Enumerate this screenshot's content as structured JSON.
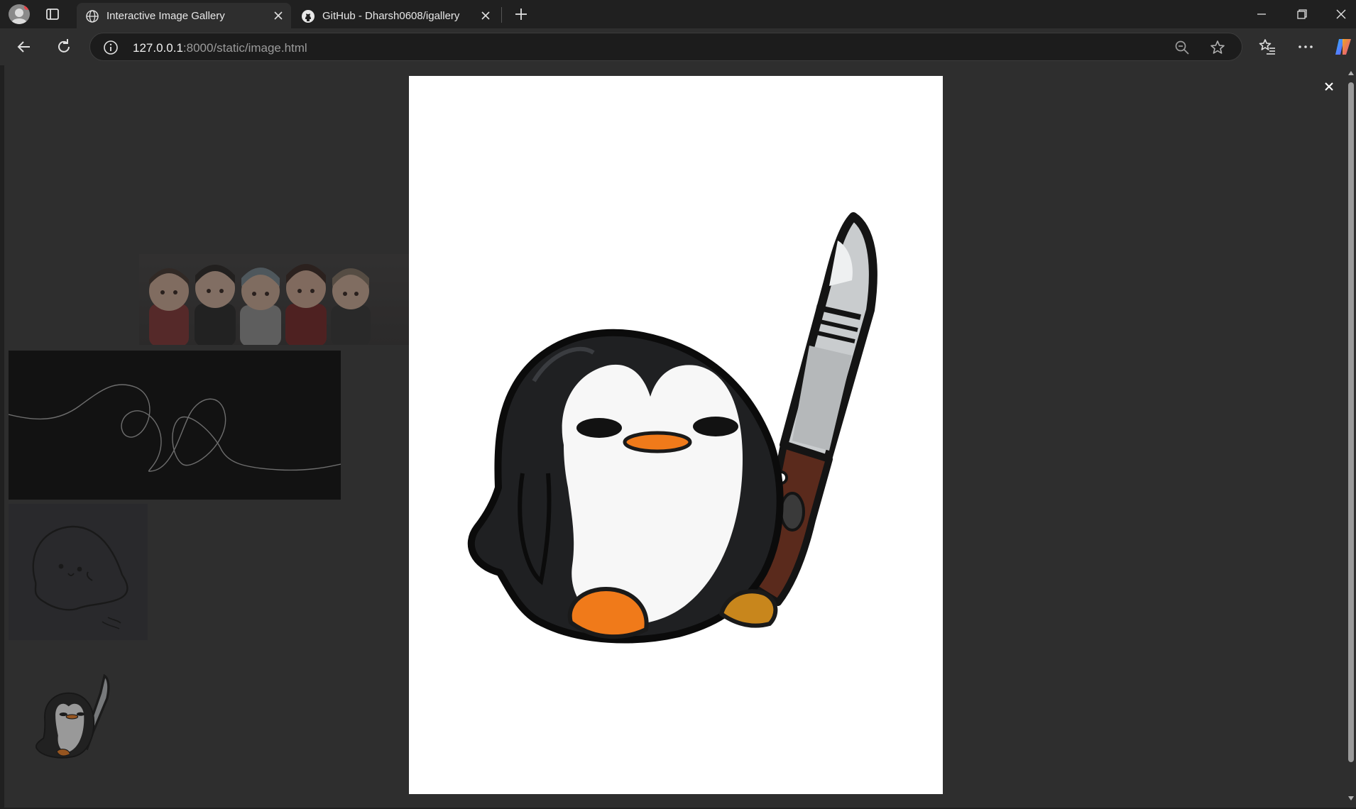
{
  "browser": {
    "tabs": [
      {
        "title": "Interactive Image Gallery",
        "icon": "globe-icon",
        "active": true
      },
      {
        "title": "GitHub - Dharsh0608/igallery",
        "icon": "github-icon",
        "active": false
      }
    ],
    "address": {
      "host": "127.0.0.1",
      "rest": ":8000/static/image.html"
    }
  },
  "gallery": {
    "images": [
      {
        "name": "bts-chibi-group"
      },
      {
        "name": "heart-line-art"
      },
      {
        "name": "ghost-sketch"
      },
      {
        "name": "penguin-with-knife"
      }
    ],
    "lightbox": {
      "image": "penguin-with-knife",
      "open": true
    }
  },
  "colors": {
    "page_bg": "#333333",
    "lightbox_bg": "#ffffff",
    "penguin_beak": "#f07a1a"
  }
}
